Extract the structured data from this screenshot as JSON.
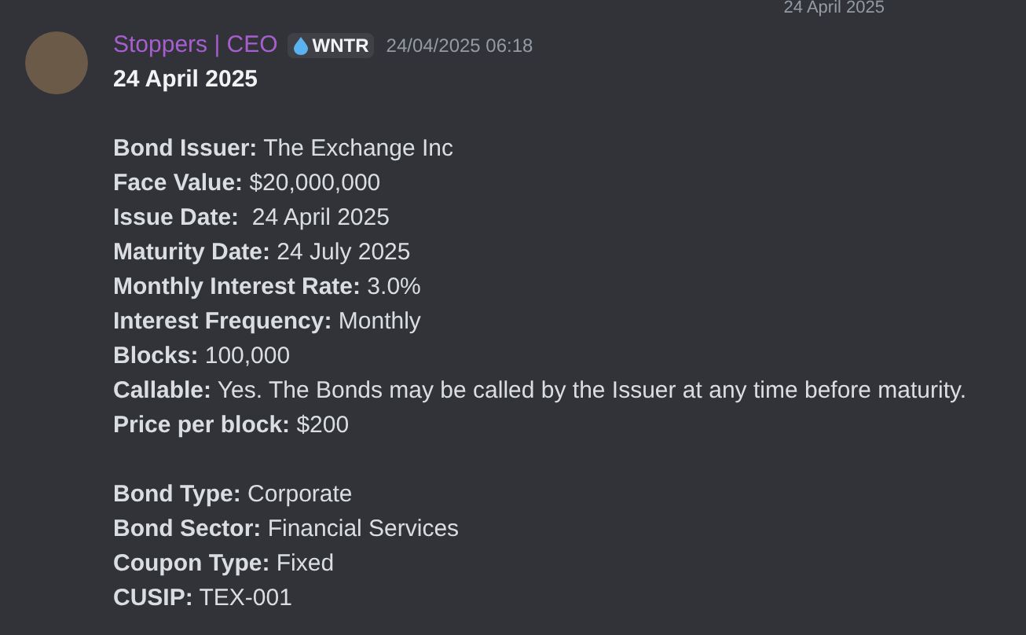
{
  "divider_date": "24 April 2025",
  "message": {
    "author": "Stoppers | CEO",
    "tag": "WNTR",
    "timestamp": "24/04/2025 06:18",
    "title": "24 April 2025",
    "sections": [
      [
        "**Bond Issuer:** The Exchange Inc",
        "**Face Value:** $20,000,000",
        "**Issue Date:**  24 April 2025",
        "**Maturity Date:** 24 July 2025",
        "**Monthly Interest Rate:** 3.0%",
        "**Interest Frequency:** Monthly",
        "**Blocks:** 100,000",
        "**Callable:** Yes. The Bonds may be called by the Issuer at any time before maturity.",
        "**Price per block:** $200"
      ],
      [
        "**Bond Type:** Corporate",
        "**Bond Sector:** Financial Services",
        "**Coupon Type:** Fixed",
        "**CUSIP:** TEX-001"
      ]
    ]
  }
}
